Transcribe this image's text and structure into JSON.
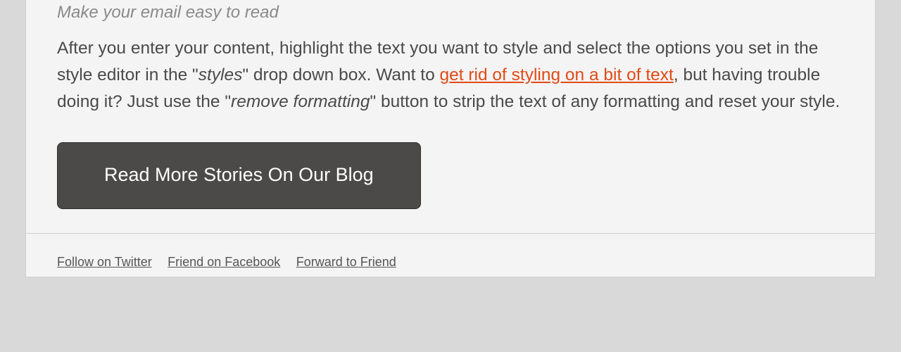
{
  "tagline": "Make your email easy to read",
  "paragraph": {
    "t1": "After you enter your content, highlight the text you want to style and select the options you set in the style editor in the \"",
    "styles_word": "styles",
    "t2": "\" drop down box. Want to ",
    "link_text": "get rid of styling on a bit of text",
    "t3": ", but having trouble doing it? Just use the \"",
    "remove_fmt": "remove formatting",
    "t4": "\" button to strip the text of any formatting and reset your style."
  },
  "cta_label": "Read More Stories On Our Blog",
  "footer_links": {
    "twitter": "Follow on Twitter",
    "facebook": "Friend on Facebook",
    "forward": "Forward to Friend"
  }
}
